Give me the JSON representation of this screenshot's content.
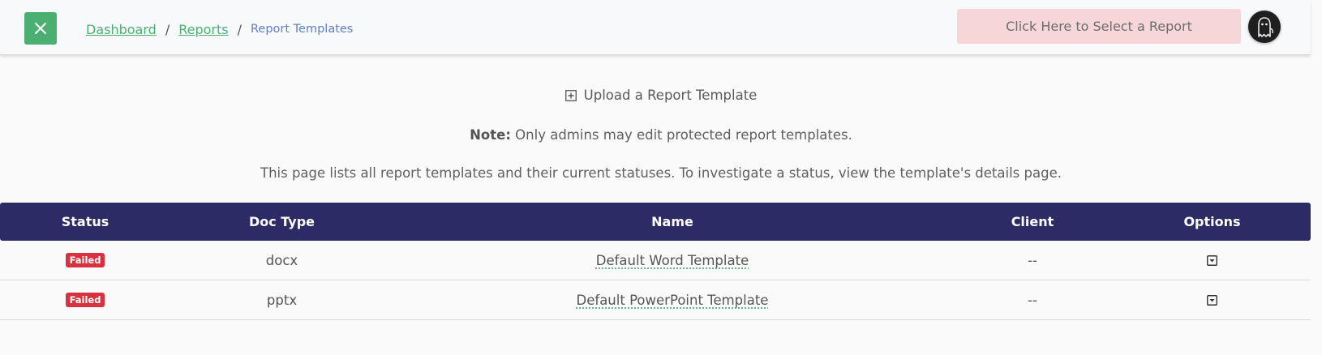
{
  "header": {
    "breadcrumb": {
      "dashboard": "Dashboard",
      "reports": "Reports",
      "current": "Report Templates",
      "separator": "/"
    },
    "select_report_label": "Click Here to Select a Report",
    "toggle_icon": "close-icon",
    "avatar_icon": "ghost-avatar-icon"
  },
  "main": {
    "upload_label": "Upload a Report Template",
    "note_label": "Note:",
    "note_text": " Only admins may edit protected report templates.",
    "description": "This page lists all report templates and their current statuses. To investigate a status, view the template's details page."
  },
  "table": {
    "columns": [
      "Status",
      "Doc Type",
      "Name",
      "Client",
      "Options"
    ],
    "rows": [
      {
        "status": "Failed",
        "doc_type": "docx",
        "name": "Default Word Template",
        "client": "--"
      },
      {
        "status": "Failed",
        "doc_type": "pptx",
        "name": "Default PowerPoint Template",
        "client": "--"
      }
    ]
  },
  "colors": {
    "accent_green": "#4caf72",
    "header_navy": "#2d2b66",
    "failed_red": "#d9323f",
    "select_report_bg": "#f7d6d9"
  }
}
